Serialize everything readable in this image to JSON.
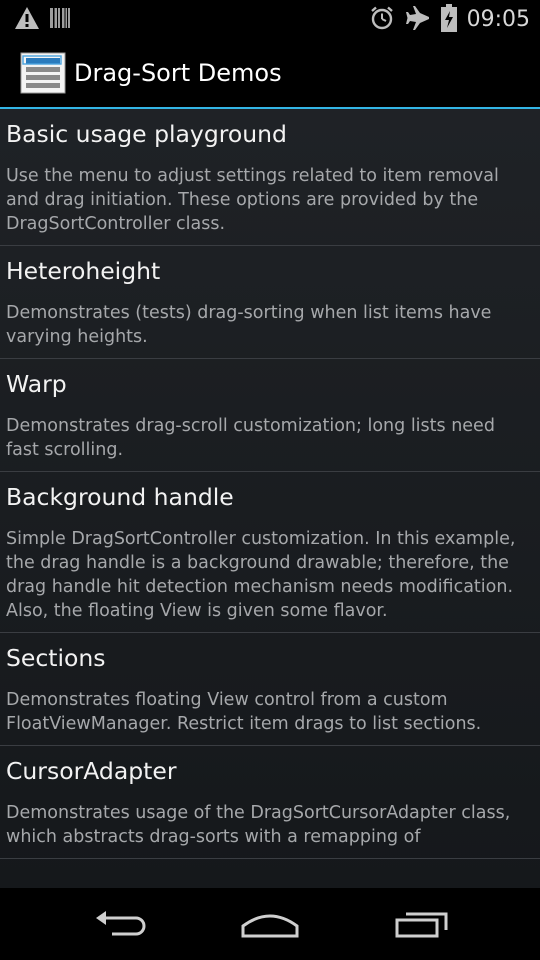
{
  "status_bar": {
    "time": "09:05",
    "left_icons": [
      "warning-icon",
      "barcode-icon"
    ],
    "right_icons": [
      "alarm-icon",
      "airplane-mode-icon",
      "battery-charging-icon"
    ]
  },
  "action_bar": {
    "title": "Drag-Sort Demos",
    "icon": "app-list-icon",
    "accent_color": "#33b5e5"
  },
  "demos": [
    {
      "title": "Basic usage playground",
      "description": "Use the menu to adjust settings related to item removal and drag initiation. These options are provided by the DragSortController class."
    },
    {
      "title": "Heteroheight",
      "description": "Demonstrates (tests) drag-sorting when list items have varying heights."
    },
    {
      "title": "Warp",
      "description": "Demonstrates drag-scroll customization; long lists need fast scrolling."
    },
    {
      "title": "Background handle",
      "description": "Simple DragSortController customization. In this example, the drag handle is a background drawable; therefore, the drag handle hit detection mechanism needs modification. Also, the floating View is given some flavor."
    },
    {
      "title": "Sections",
      "description": "Demonstrates floating View control from a custom FloatViewManager. Restrict item drags to list sections."
    },
    {
      "title": "CursorAdapter",
      "description": "Demonstrates usage of the DragSortCursorAdapter class, which abstracts drag-sorts with a remapping of"
    }
  ],
  "nav_bar": {
    "buttons": [
      "back-icon",
      "home-icon",
      "recent-apps-icon"
    ]
  }
}
